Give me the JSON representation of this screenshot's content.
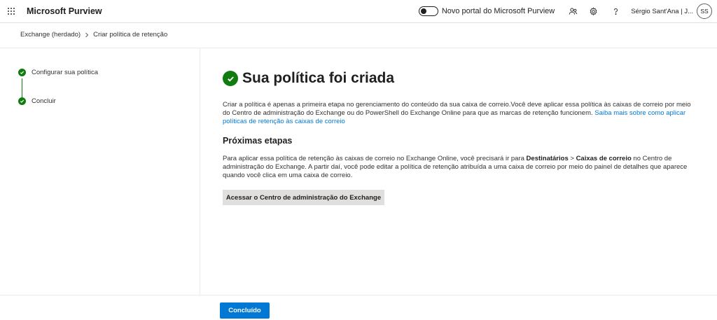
{
  "topbar": {
    "app_title": "Microsoft Purview",
    "toggle_label": "Novo portal do Microsoft Purview",
    "user_name": "Sérgio Sant'Ana | J...",
    "avatar_initials": "SS",
    "icons": [
      "app-launcher-icon",
      "people-icon",
      "gear-icon",
      "help-icon"
    ]
  },
  "breadcrumb": {
    "items": [
      "Exchange (herdado)",
      "Criar política de retenção"
    ]
  },
  "steps": [
    {
      "label": "Configurar sua política",
      "status": "completed"
    },
    {
      "label": "Concluir",
      "status": "completed"
    }
  ],
  "main": {
    "title": "Sua política foi criada",
    "intro_text": "Criar a política é apenas a primeira etapa no gerenciamento do conteúdo da sua caixa de correio.Você deve aplicar essa política às caixas de correio por meio do Centro de administração do Exchange ou do PowerShell do Exchange Online para que as marcas de retenção funcionem. ",
    "intro_link": "Saiba mais sobre como aplicar políticas de retenção às caixas de correio",
    "next_title": "Próximas etapas",
    "next_text_1": "Para aplicar essa política de retenção às caixas de correio no Exchange Online, você precisará ir para ",
    "next_bold_1": "Destinatários",
    "next_text_2": " > ",
    "next_bold_2": "Caixas de correio",
    "next_text_3": " no Centro de administração do Exchange. A partir daí, você pode editar a política de retenção atribuída a uma caixa de correio por meio do painel de detalhes que aparece quando você clica em uma caixa de correio.",
    "exchange_button": "Acessar o Centro de administração do Exchange"
  },
  "footer": {
    "done_button": "Concluído"
  },
  "colors": {
    "accent": "#0078d4",
    "success": "#107c10"
  }
}
